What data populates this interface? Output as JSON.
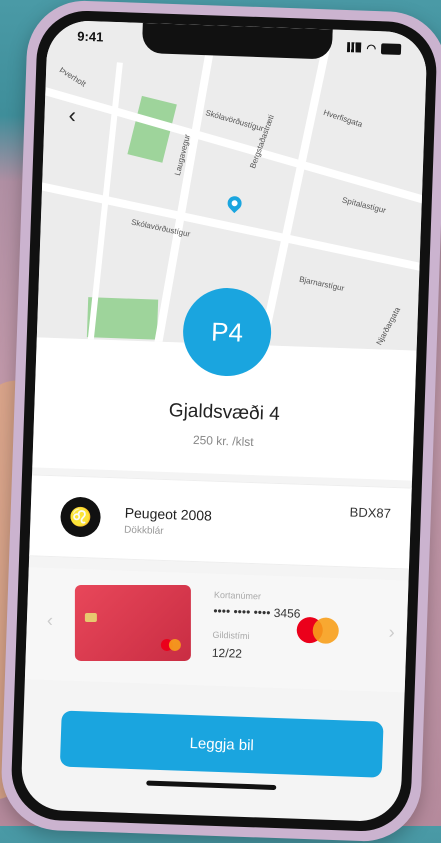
{
  "status_bar": {
    "time": "9:41"
  },
  "map": {
    "streets": [
      "Þverholt",
      "Skólavörðustígur",
      "Laugavegur",
      "Hverfisgata",
      "Bergstaðastræti",
      "Bjarnarstígur",
      "Spítalastígur",
      "Skólavörðustígur",
      "Njarðargata"
    ],
    "pin_color": "#1aa5df"
  },
  "zone": {
    "badge": "P4",
    "name": "Gjaldsvæði 4",
    "rate": "250 kr. /klst"
  },
  "car": {
    "brand_icon": "peugeot-lion-icon",
    "model": "Peugeot 2008",
    "color": "Dökkblár",
    "plate": "BDX87"
  },
  "payment": {
    "card_number_label": "Kortanúmer",
    "card_number": "•••• •••• •••• 3456",
    "expiry_label": "Gildistími",
    "expiry": "12/22",
    "card_brand": "mastercard-icon"
  },
  "action": {
    "label": "Leggja bil"
  },
  "colors": {
    "accent": "#1aa5df"
  }
}
